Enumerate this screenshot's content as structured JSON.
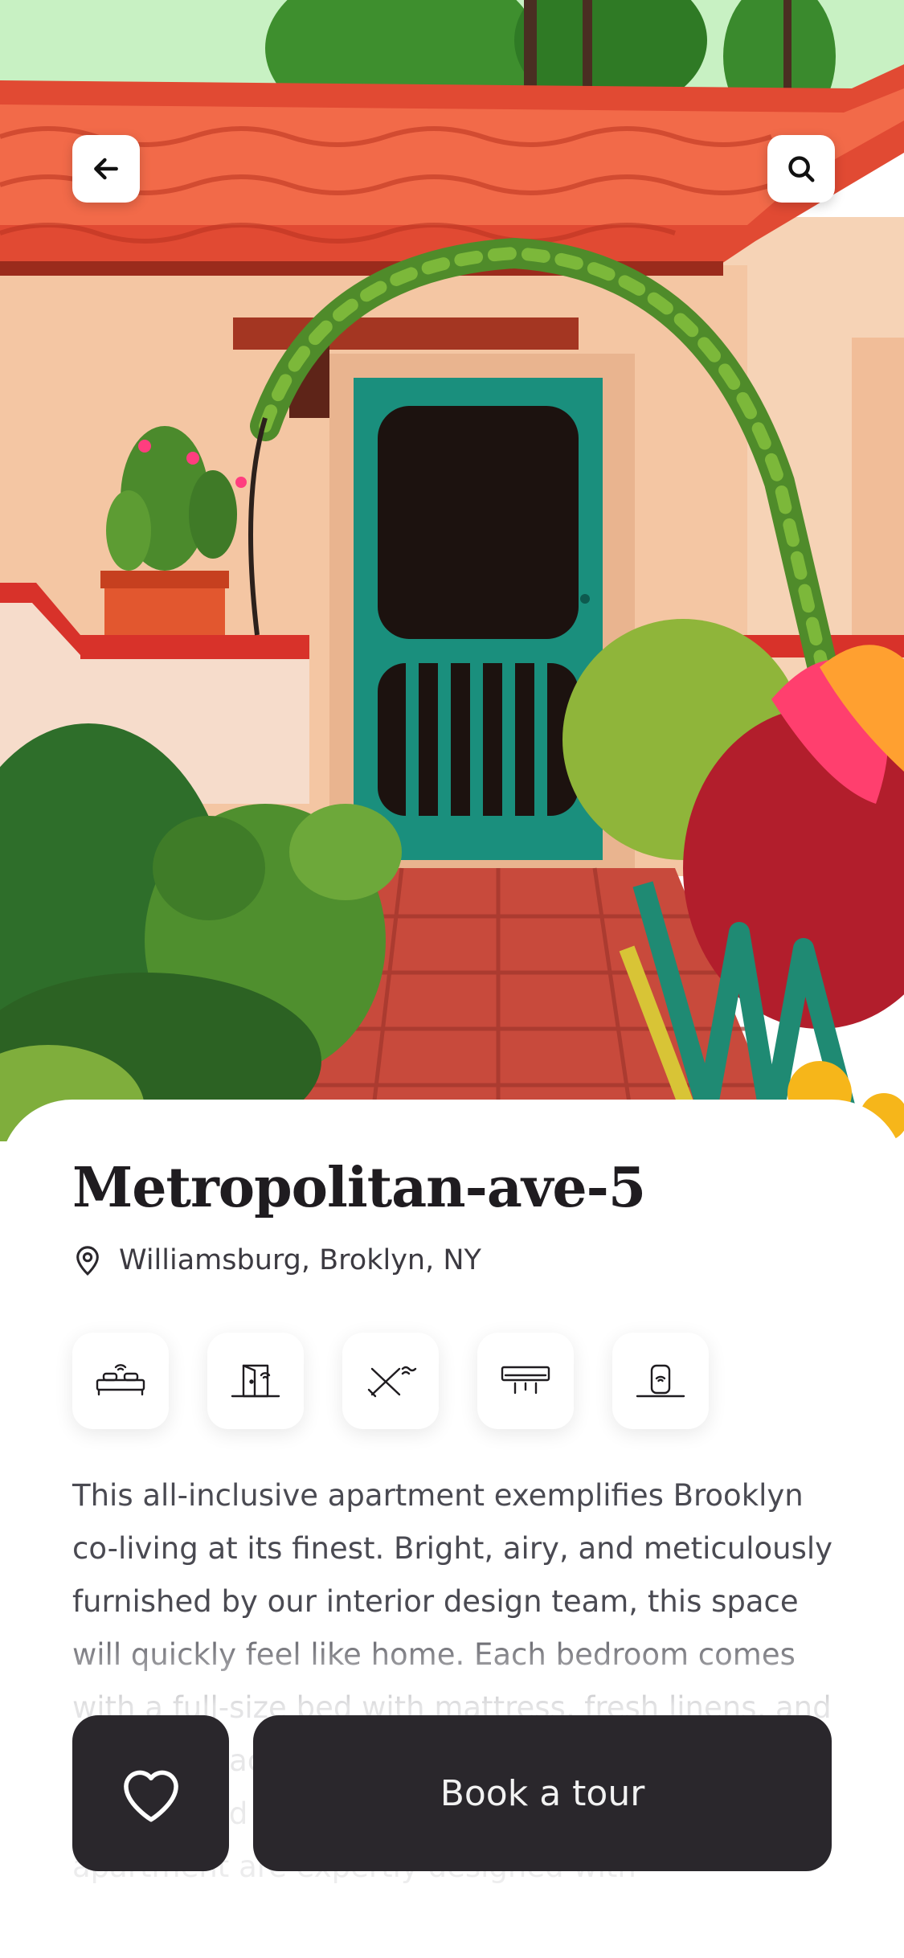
{
  "nav": {
    "back_icon": "arrow-left-icon",
    "search_icon": "search-icon"
  },
  "listing": {
    "title": "Metropolitan-ave-5",
    "location": "Williamsburg, Broklyn, NY",
    "location_icon": "map-pin-icon",
    "amenities": [
      {
        "icon": "smart-bed-icon"
      },
      {
        "icon": "smart-door-icon"
      },
      {
        "icon": "no-smoking-icon"
      },
      {
        "icon": "air-conditioner-icon"
      },
      {
        "icon": "smart-speaker-icon"
      }
    ],
    "description": "This all-inclusive apartment exemplifies Brooklyn co-living at its finest. Bright, airy, and meticulously furnished by our interior design team, this space will quickly feel like home. Each bedroom comes with a full-size bed with mattress, fresh linens, and storage space. The kitchen is fully equipped with glasses and cookware. The common spaces in the apartment are expertly designed with"
  },
  "actions": {
    "favorite_icon": "heart-icon",
    "book_label": "Book a tour"
  },
  "colors": {
    "primary_dark": "#2a272c",
    "title_text": "#1f1c20",
    "body_text": "#4a4a52",
    "roof": "#e8503a",
    "door": "#1f9a86",
    "wall": "#f4c6a3"
  }
}
